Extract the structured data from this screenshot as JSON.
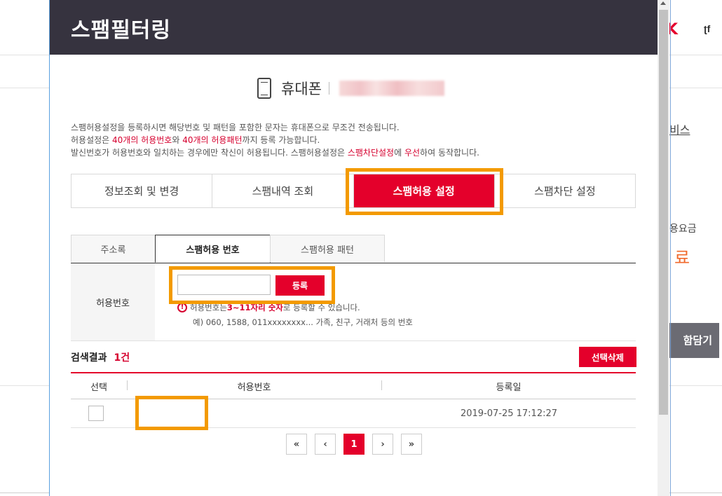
{
  "background": {
    "brand_mark": "K",
    "brand_text": "f",
    "side_texts": [
      "비스",
      "용요금",
      "료"
    ],
    "cart_button": "함담기"
  },
  "popup": {
    "title": "스팸필터링",
    "device_label": "휴대폰",
    "notice": {
      "line1": "스팸허용설정을 등록하시면 해당번호 및 패턴을 포함한 문자는 휴대폰으로 무조건 전송됩니다.",
      "line2_a": "허용설정은 ",
      "line2_red1": "40개의 허용번호",
      "line2_b": "와 ",
      "line2_red2": "40개의 허용패턴",
      "line2_c": "까지 등록 가능합니다.",
      "line3_a": "발신번호가 허용번호와 일치하는 경우에만 착신이 허용됩니다. 스팸허용설정은 ",
      "line3_red1": "스팸차단설정",
      "line3_b": "에 ",
      "line3_red2": "우선",
      "line3_c": "하여 동작합니다."
    },
    "main_tabs": [
      "정보조회 및 변경",
      "스팸내역 조회",
      "스팸허용 설정",
      "스팸차단 설정"
    ],
    "active_main_tab": "스팸허용 설정",
    "sub_tabs": [
      "주소록",
      "스팸허용 번호",
      "스팸허용 패턴"
    ],
    "active_sub_tab": "스팸허용 번호",
    "form": {
      "label": "허용번호",
      "input_value": "",
      "register_button": "등록",
      "help_a": "허용번호는 ",
      "help_red": "3~11자리 숫자",
      "help_b": "로 등록할 수 있습니다.",
      "help_example": "예) 060, 1588, 011xxxxxxxx... 가족, 친구, 거래처 등의 번호"
    },
    "results": {
      "title": "검색결과",
      "count": "1건",
      "delete_button": "선택삭제",
      "columns": [
        "선택",
        "허용번호",
        "등록일"
      ],
      "rows": [
        {
          "number": "",
          "date": "2019-07-25 17:12:27"
        }
      ]
    },
    "pagination": {
      "first": "«",
      "prev": "‹",
      "current": "1",
      "next": "›",
      "last": "»"
    }
  },
  "colors": {
    "accent": "#e4002b",
    "header": "#36333f",
    "highlight": "#f39a00"
  }
}
